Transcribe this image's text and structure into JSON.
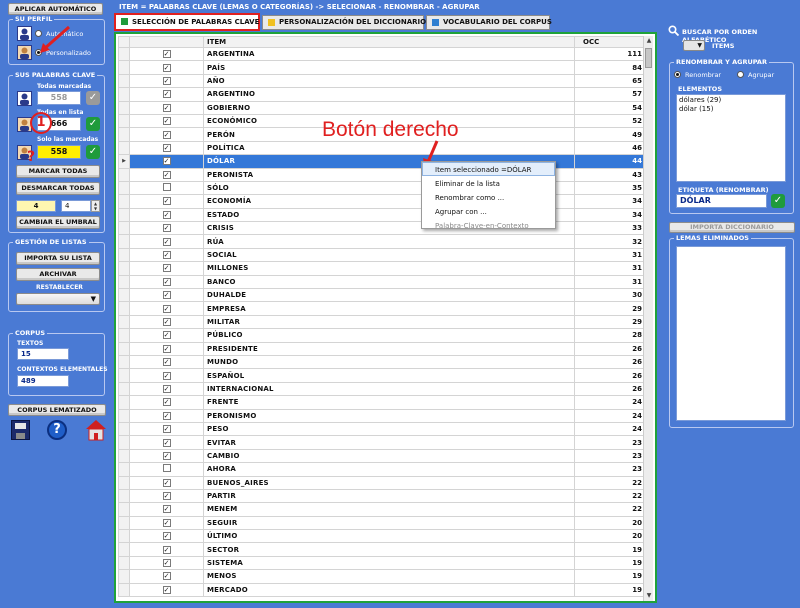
{
  "header": {
    "title": "ITEM = PALABRAS CLAVE (lemas o categorías) -> SELECIONAR - RENOMBRAR - AGRUPAR"
  },
  "left": {
    "apply_auto": "APLICAR AUTOMÁTICO",
    "profile": {
      "title": "SU PERFIL",
      "auto_label": "Automático",
      "custom_label": "Personalizado",
      "selected": "Personalizado"
    },
    "keywords": {
      "title": "SUS PALABRAS CLAVE",
      "all_marked_label": "Todas marcadas",
      "all_marked_value": "558",
      "all_in_list_label": "Todas en lista",
      "all_in_list_value": "666",
      "only_marked_label": "Solo las marcadas",
      "only_marked_value": "558",
      "mark_all": "MARCAR TODAS",
      "unmark_all": "DESMARCAR TODAS",
      "threshold_a": "4",
      "threshold_b": "4",
      "change_threshold": "CAMBIAR EL UMBRAL"
    },
    "lists": {
      "title": "GESTIÓN DE LISTAS",
      "import": "IMPORTA SU LISTA",
      "archive": "ARCHIVAR",
      "restore": "RESTABLECER",
      "restore_value": ""
    },
    "corpus": {
      "title": "CORPUS",
      "texts_label": "TEXTOS",
      "texts_value": "15",
      "contexts_label": "CONTEXTOS ELEMENTALES",
      "contexts_value": "489"
    },
    "lemmatized": "CORPUS LEMATIZADO"
  },
  "tabs": [
    {
      "label": "SELECCIÓN DE PALABRAS CLAVE",
      "color": "#1f9b3b",
      "active": true
    },
    {
      "label": "PERSONALIZACIÓN DEL DICCIONARIO",
      "color": "#f0c020",
      "active": false
    },
    {
      "label": "VOCABULARIO DEL CORPUS",
      "color": "#2f7fd0",
      "active": false
    }
  ],
  "grid": {
    "columns": [
      "ITEM",
      "OCC"
    ],
    "selected_row": 10,
    "rows": [
      {
        "item": "ARGENTINA",
        "occ": "111",
        "checked": true
      },
      {
        "item": "PAÍS",
        "occ": "84",
        "checked": true
      },
      {
        "item": "AÑO",
        "occ": "65",
        "checked": true
      },
      {
        "item": "ARGENTINO",
        "occ": "57",
        "checked": true
      },
      {
        "item": "GOBIERNO",
        "occ": "54",
        "checked": true
      },
      {
        "item": "ECONÓMICO",
        "occ": "52",
        "checked": true
      },
      {
        "item": "PERÓN",
        "occ": "49",
        "checked": true
      },
      {
        "item": "POLÍTICA",
        "occ": "46",
        "checked": true
      },
      {
        "item": "DÓLAR",
        "occ": "44",
        "checked": true
      },
      {
        "item": "PERONISTA",
        "occ": "43",
        "checked": true
      },
      {
        "item": "SÓLO",
        "occ": "35",
        "checked": false
      },
      {
        "item": "ECONOMÍA",
        "occ": "34",
        "checked": true
      },
      {
        "item": "ESTADO",
        "occ": "34",
        "checked": true
      },
      {
        "item": "CRISIS",
        "occ": "33",
        "checked": true
      },
      {
        "item": "RÚA",
        "occ": "32",
        "checked": true
      },
      {
        "item": "SOCIAL",
        "occ": "31",
        "checked": true
      },
      {
        "item": "MILLONES",
        "occ": "31",
        "checked": true
      },
      {
        "item": "BANCO",
        "occ": "31",
        "checked": true
      },
      {
        "item": "DUHALDE",
        "occ": "30",
        "checked": true
      },
      {
        "item": "EMPRESA",
        "occ": "29",
        "checked": true
      },
      {
        "item": "MILITAR",
        "occ": "29",
        "checked": true
      },
      {
        "item": "PÚBLICO",
        "occ": "28",
        "checked": true
      },
      {
        "item": "PRESIDENTE",
        "occ": "26",
        "checked": true
      },
      {
        "item": "MUNDO",
        "occ": "26",
        "checked": true
      },
      {
        "item": "ESPAÑOL",
        "occ": "26",
        "checked": true
      },
      {
        "item": "INTERNACIONAL",
        "occ": "26",
        "checked": true
      },
      {
        "item": "FRENTE",
        "occ": "24",
        "checked": true
      },
      {
        "item": "PERONISMO",
        "occ": "24",
        "checked": true
      },
      {
        "item": "PESO",
        "occ": "24",
        "checked": true
      },
      {
        "item": "EVITAR",
        "occ": "23",
        "checked": true
      },
      {
        "item": "CAMBIO",
        "occ": "23",
        "checked": true
      },
      {
        "item": "AHORA",
        "occ": "23",
        "checked": false
      },
      {
        "item": "BUENOS_AIRES",
        "occ": "22",
        "checked": true
      },
      {
        "item": "PARTIR",
        "occ": "22",
        "checked": true
      },
      {
        "item": "MENEM",
        "occ": "22",
        "checked": true
      },
      {
        "item": "SEGUIR",
        "occ": "20",
        "checked": true
      },
      {
        "item": "ÚLTIMO",
        "occ": "20",
        "checked": true
      },
      {
        "item": "SECTOR",
        "occ": "19",
        "checked": true
      },
      {
        "item": "SISTEMA",
        "occ": "19",
        "checked": true
      },
      {
        "item": "MENOS",
        "occ": "19",
        "checked": true
      },
      {
        "item": "MERCADO",
        "occ": "19",
        "checked": true
      }
    ]
  },
  "context_menu": {
    "items": [
      "Item seleccionado =DÓLAR",
      "Eliminar de la lista",
      "Renombrar como ...",
      "Agrupar con ...",
      "Palabra-Clave-en-Contexto"
    ]
  },
  "annotation": {
    "text": "Botón derecho",
    "marks": [
      "1",
      "?"
    ]
  },
  "right": {
    "search_label": "BUSCAR POR ORDEN ALFABÉTICO",
    "items_label": "ITEMS",
    "search_value": "",
    "rename_group": {
      "title": "RENOMBRAR Y AGRUPAR",
      "rename": "Renombrar",
      "group": "Agrupar",
      "selected": "Renombrar",
      "elements_label": "ELEMENTOS",
      "elements": [
        "dólares (29)",
        "dólar (15)"
      ],
      "tag_label": "ETIQUETA (RENOMBRAR)",
      "tag_value": "DÓLAR"
    },
    "import_dict": "IMPORTA DICCIONARIO",
    "removed_title": "LEMAS ELIMINADOS"
  },
  "colors": {
    "background": "#4a7ad4",
    "accent": "#1f9b3b",
    "highlight": "#e02020",
    "selection": "#3478d8"
  }
}
